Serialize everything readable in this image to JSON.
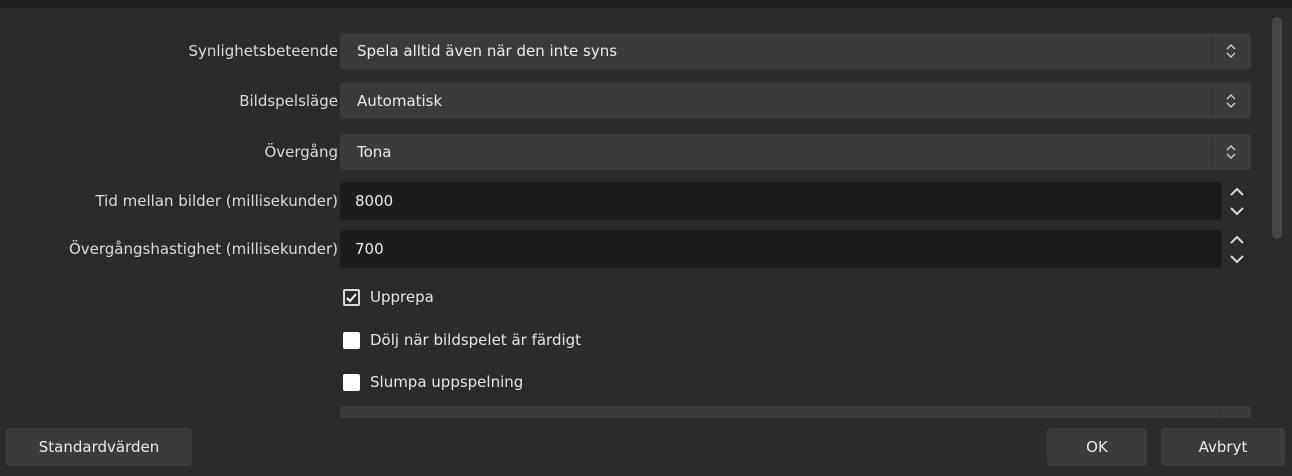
{
  "properties": {
    "visibility_behavior": {
      "label": "Synlighetsbeteende",
      "value": "Spela alltid även när den inte syns"
    },
    "slide_mode": {
      "label": "Bildspelsläge",
      "value": "Automatisk"
    },
    "transition": {
      "label": "Övergång",
      "value": "Tona"
    },
    "slide_time": {
      "label": "Tid mellan bilder (millisekunder)",
      "value": "8000"
    },
    "transition_speed": {
      "label": "Övergångshastighet (millisekunder)",
      "value": "700"
    },
    "loop": {
      "label": "Upprepa",
      "checked": true
    },
    "hide_when_done": {
      "label": "Dölj när bildspelet är färdigt",
      "checked": false
    },
    "randomize": {
      "label": "Slumpa uppspelning",
      "checked": false
    }
  },
  "footer": {
    "defaults_label": "Standardvärden",
    "ok_label": "OK",
    "cancel_label": "Avbryt"
  },
  "icons": {
    "combo_arrows": "updown-chevron-icon",
    "spin_up": "chevron-up-icon",
    "spin_down": "chevron-down-icon",
    "checkmark": "checkmark-icon"
  },
  "colors": {
    "background": "#2b2b2b",
    "control": "#3b3b3b",
    "input": "#1c1c1c",
    "text": "#dcdcdc"
  }
}
